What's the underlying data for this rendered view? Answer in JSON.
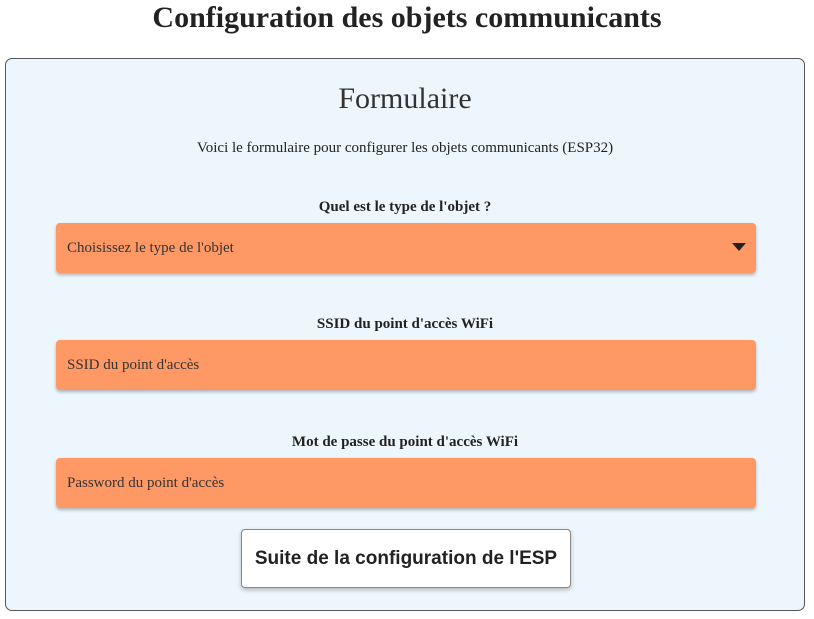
{
  "page": {
    "title": "Configuration des objets communicants"
  },
  "form": {
    "heading": "Formulaire",
    "description": "Voici le formulaire pour configurer les objets communicants (ESP32)",
    "object_type": {
      "label": "Quel est le type de l'objet ?",
      "selected_value": "Choisissez le type de l'objet"
    },
    "ssid": {
      "label": "SSID du point d'accès WiFi",
      "placeholder": "SSID du point d'accès",
      "value": ""
    },
    "password": {
      "label": "Mot de passe du point d'accès WiFi",
      "placeholder": "Password du point d'accès",
      "value": ""
    },
    "submit_label": "Suite de la configuration de l'ESP"
  },
  "colors": {
    "field_background": "#fe9966",
    "card_background": "#eef6fd",
    "card_border": "#555555"
  },
  "icons": {
    "select_arrow": "caret-down-icon"
  }
}
